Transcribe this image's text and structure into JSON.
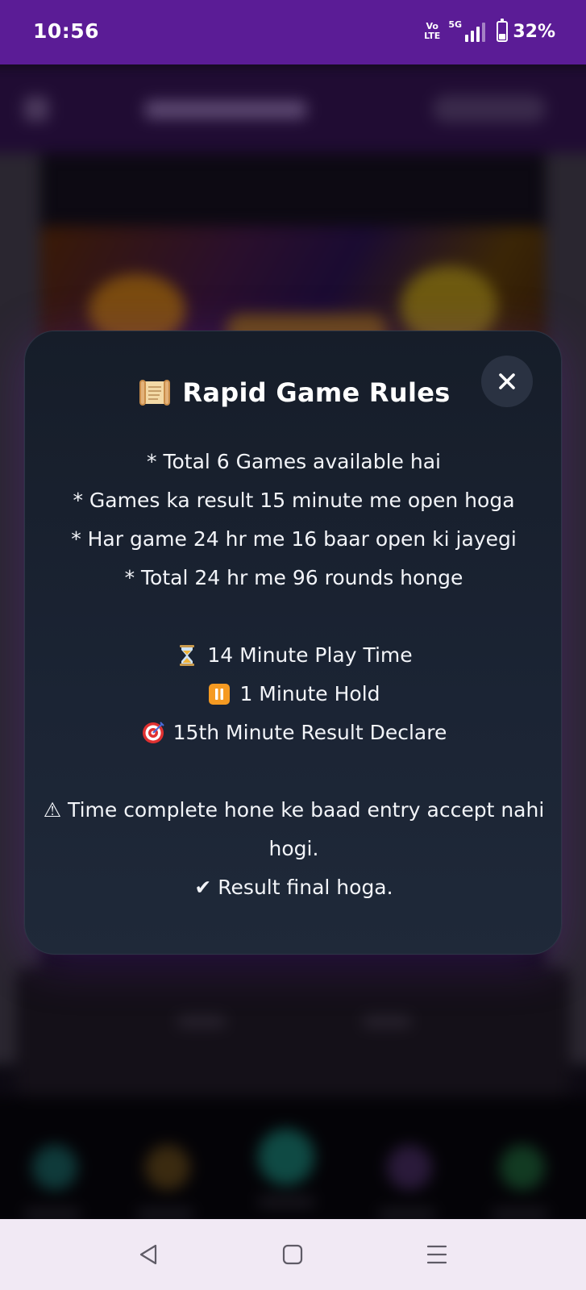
{
  "status_bar": {
    "time": "10:56",
    "volte_top": "Vo",
    "volte_bottom": "LTE",
    "network": "5G",
    "battery": "32%",
    "battery_level": 0.32,
    "background_color": "#5b1c96"
  },
  "modal": {
    "title_icon": "scroll-icon",
    "title": "Rapid Game Rules",
    "close_icon": "close-icon",
    "rules": [
      "* Total 6 Games available hai",
      "* Games ka result 15 minute me open hoga",
      "* Har game 24 hr me 16 baar open ki jayegi",
      "* Total 24 hr me 96 rounds honge"
    ],
    "timing": [
      {
        "icon": "hourglass-icon",
        "text": "14 Minute Play Time"
      },
      {
        "icon": "pause-icon",
        "text": "1 Minute Hold"
      },
      {
        "icon": "target-icon",
        "text": "15th Minute Result Declare"
      }
    ],
    "warning": "⚠ Time complete hone ke baad entry accept nahi hogi.",
    "final": "✔ Result final hoga.",
    "background_color": "#1b2434"
  },
  "system_nav": {
    "back_icon": "back-triangle-icon",
    "home_icon": "home-square-icon",
    "menu_icon": "menu-lines-icon"
  }
}
